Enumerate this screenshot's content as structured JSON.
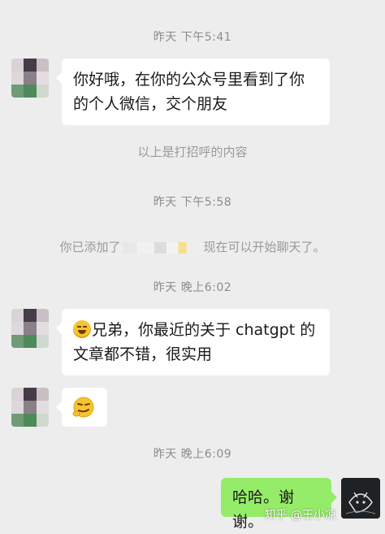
{
  "chat": {
    "ts1": "昨天 下午5:41",
    "msg1_line1": "你好哦，在你的公众号里看到了你",
    "msg1_line2": "的个人微信，交个朋友",
    "greeting_note": "以上是打招呼的内容",
    "ts2": "昨天 下午5:58",
    "added_prefix": "你已添加了",
    "added_suffix": "现在可以开始聊天了。",
    "ts3": "昨天 晚上6:02",
    "msg2_line1": "兄弟，你最近的关于 chatgpt 的",
    "msg2_line2": "文章都不错，很实用",
    "ts4": "昨天 晚上6:09",
    "reply": "哈哈。谢谢。"
  },
  "watermark": "知乎 @王小凉",
  "colors": {
    "background": "#ededed",
    "my_bubble": "#95ec69",
    "their_bubble": "#ffffff"
  },
  "icons": {
    "grin_emoji": "grinning-face-emoji",
    "wink_emoji": "sly-smile-emoji"
  }
}
